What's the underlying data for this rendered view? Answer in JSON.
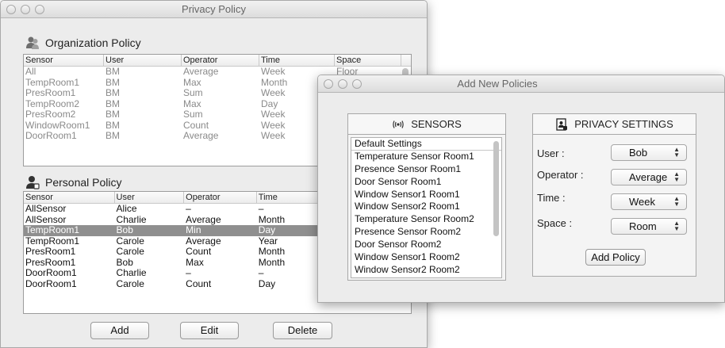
{
  "privacy_window": {
    "title": "Privacy Policy",
    "org_section_title": "Organization Policy",
    "org_columns": [
      "Sensor",
      "User",
      "Operator",
      "Time",
      "Space"
    ],
    "org_rows": [
      [
        "All",
        "BM",
        "Average",
        "Week",
        "Floor"
      ],
      [
        "TempRoom1",
        "BM",
        "Max",
        "Month",
        ""
      ],
      [
        "PresRoom1",
        "BM",
        "Sum",
        "Week",
        ""
      ],
      [
        "TempRoom2",
        "BM",
        "Max",
        "Day",
        ""
      ],
      [
        "PresRoom2",
        "BM",
        "Sum",
        "Week",
        ""
      ],
      [
        "WindowRoom1",
        "BM",
        "Count",
        "Week",
        ""
      ],
      [
        "DoorRoom1",
        "BM",
        "Average",
        "Week",
        ""
      ]
    ],
    "personal_section_title": "Personal Policy",
    "personal_columns": [
      "Sensor",
      "User",
      "Operator",
      "Time"
    ],
    "personal_rows": [
      [
        "AllSensor",
        "Alice",
        "–",
        "–"
      ],
      [
        "AllSensor",
        "Charlie",
        "Average",
        "Month"
      ],
      [
        "TempRoom1",
        "Bob",
        "Min",
        "Day"
      ],
      [
        "TempRoom1",
        "Carole",
        "Average",
        "Year"
      ],
      [
        "PresRoom1",
        "Carole",
        "Count",
        "Month"
      ],
      [
        "PresRoom1",
        "Bob",
        "Max",
        "Month"
      ],
      [
        "DoorRoom1",
        "Charlie",
        "–",
        "–"
      ],
      [
        "DoorRoom1",
        "Carole",
        "Count",
        "Day"
      ]
    ],
    "selected_personal_row": 2,
    "buttons": {
      "add": "Add",
      "edit": "Edit",
      "delete": "Delete"
    }
  },
  "add_window": {
    "title": "Add New Policies",
    "sensors_header": "SENSORS",
    "sensors_icon": "sensor-waves-icon",
    "sensors": [
      "Default Settings",
      "Temperature Sensor Room1",
      "Presence Sensor Room1",
      "Door Sensor Room1",
      "Window Sensor1 Room1",
      "Window Sensor2 Room1",
      "Temperature Sensor Room2",
      "Presence Sensor Room2",
      "Door Sensor Room2",
      "Window Sensor1 Room2",
      "Window Sensor2 Room2"
    ],
    "privacy_header": "PRIVACY SETTINGS",
    "privacy_icon": "privacy-settings-icon",
    "fields": {
      "user_label": "User :",
      "user_value": "Bob",
      "operator_label": "Operator :",
      "operator_value": "Average",
      "time_label": "Time :",
      "time_value": "Week",
      "space_label": "Space :",
      "space_value": "Room"
    },
    "add_policy_label": "Add Policy"
  },
  "colors": {
    "selection": "#8f8f8f",
    "window_bg": "#ececec"
  }
}
